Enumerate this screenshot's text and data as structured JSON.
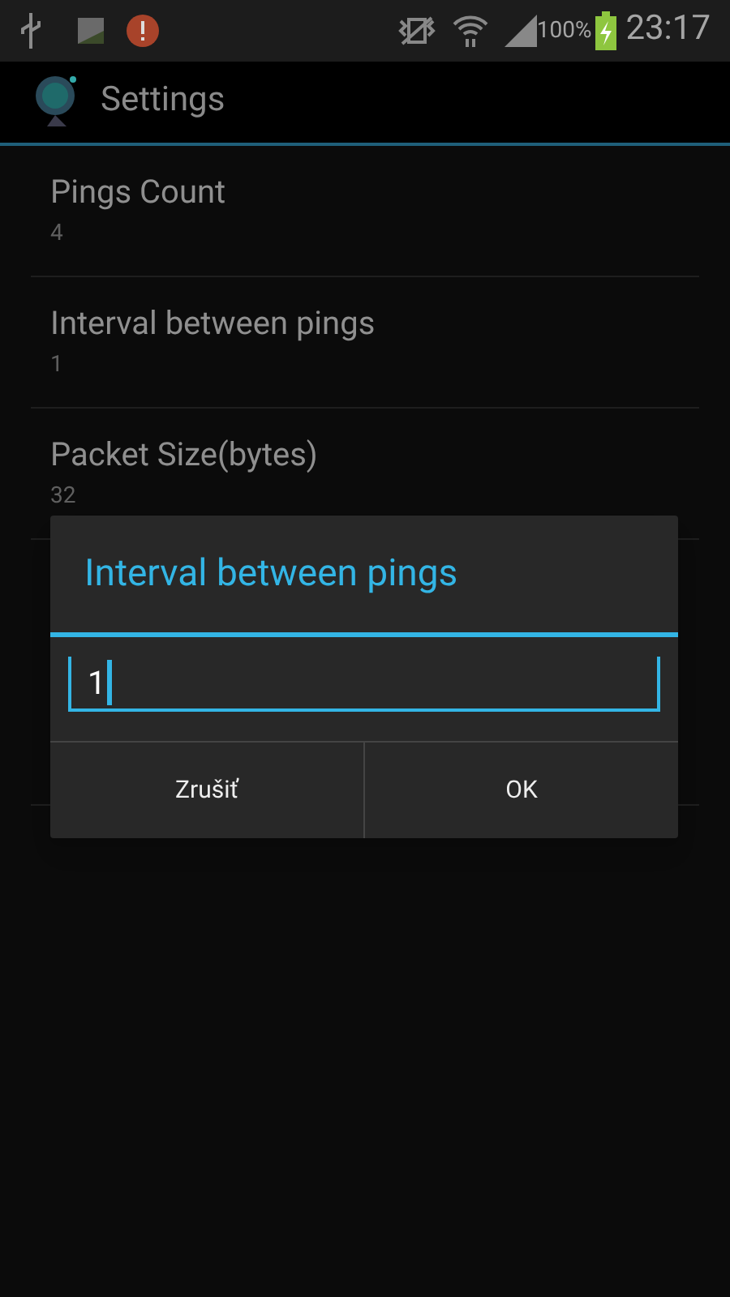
{
  "status_bar": {
    "battery": "100%",
    "time": "23:17"
  },
  "action_bar": {
    "title": "Settings"
  },
  "preferences": [
    {
      "title": "Pings Count",
      "value": "4"
    },
    {
      "title": "Interval between pings",
      "value": "1"
    },
    {
      "title": "Packet Size(bytes)",
      "value": "32"
    }
  ],
  "dialog": {
    "title": "Interval between pings",
    "input": {
      "value": "1"
    },
    "buttons": [
      {
        "label": "Zrušiť"
      },
      {
        "label": "OK"
      }
    ]
  }
}
